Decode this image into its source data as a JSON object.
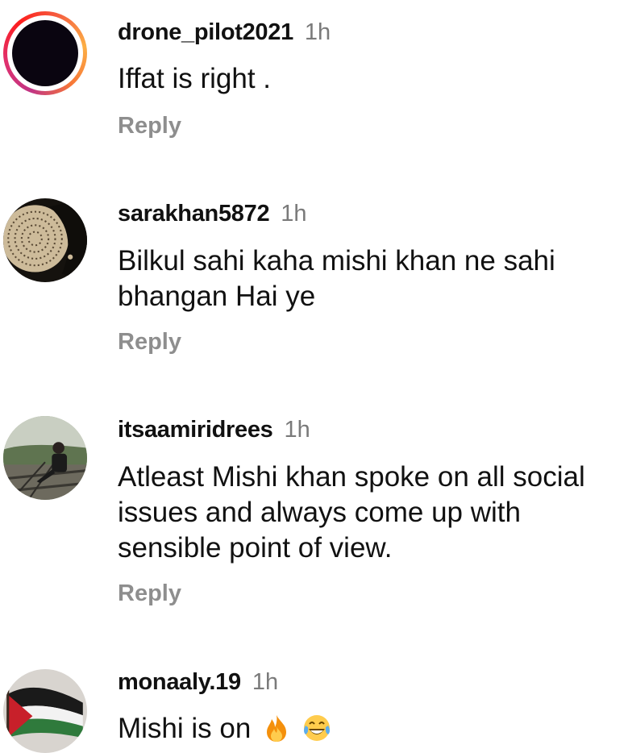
{
  "comments": [
    {
      "username": "drone_pilot2021",
      "time": "1h",
      "text": "Iffat is right .",
      "reply_label": "Reply",
      "avatar_icon": "story-ring-avatar"
    },
    {
      "username": "sarakhan5872",
      "time": "1h",
      "text": "Bilkul sahi kaha mishi khan ne sahi bhangan Hai ye",
      "reply_label": "Reply",
      "avatar_icon": "pattern-avatar"
    },
    {
      "username": "itsaamiridrees",
      "time": "1h",
      "text": "Atleast Mishi khan spoke on all social issues and always come up with sensible point of view.",
      "reply_label": "Reply",
      "avatar_icon": "photo-avatar"
    },
    {
      "username": "monaaly.19",
      "time": "1h",
      "text": "Mishi is on",
      "emojis": [
        "fire-emoji",
        "joy-emoji"
      ],
      "avatar_icon": "flag-avatar"
    }
  ],
  "colors": {
    "username": "#111111",
    "time": "#7a7a7a",
    "reply": "#8e8e8e",
    "story_ring": "#e1306c"
  }
}
